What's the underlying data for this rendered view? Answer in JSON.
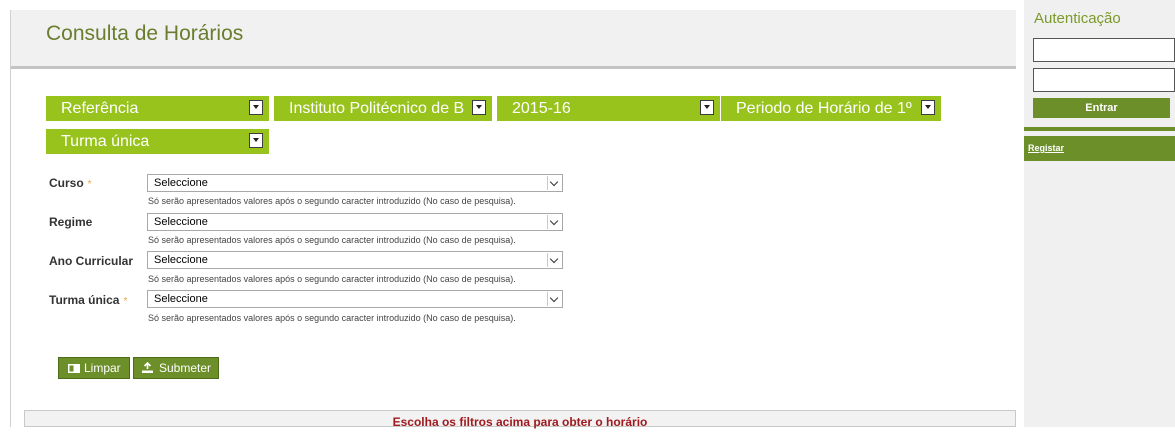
{
  "header": {
    "title": "Consulta de Horários"
  },
  "filters": [
    {
      "label": "Referência"
    },
    {
      "label": "Instituto Politécnico de B"
    },
    {
      "label": "2015-16"
    },
    {
      "label": "Periodo de Horário de 1º"
    },
    {
      "label": "Turma única"
    }
  ],
  "form": {
    "fields": [
      {
        "label": "Curso",
        "required": "*",
        "value": "Seleccione"
      },
      {
        "label": "Regime",
        "value": "Seleccione"
      },
      {
        "label": "Ano Curricular",
        "value": "Seleccione"
      },
      {
        "label": "Turma única",
        "required": "*",
        "value": "Seleccione"
      }
    ],
    "hint": "Só serão apresentados valores após o segundo caracter introduzido (No caso de pesquisa).",
    "clear_label": "Limpar",
    "submit_label": "Submeter"
  },
  "result": {
    "message": "Escolha os filtros acima para obter o horário"
  },
  "sidebar": {
    "auth_title": "Autenticação",
    "username": "",
    "password": "",
    "enter_label": "Entrar",
    "register_label": "Registar"
  },
  "colors": {
    "accent": "#97c31c",
    "dark_green": "#6c8f2a",
    "title_green": "#6a7d2e",
    "message_red": "#a0191e"
  },
  "icons": [
    "chevron-down-icon",
    "eraser-icon",
    "upload-icon"
  ]
}
